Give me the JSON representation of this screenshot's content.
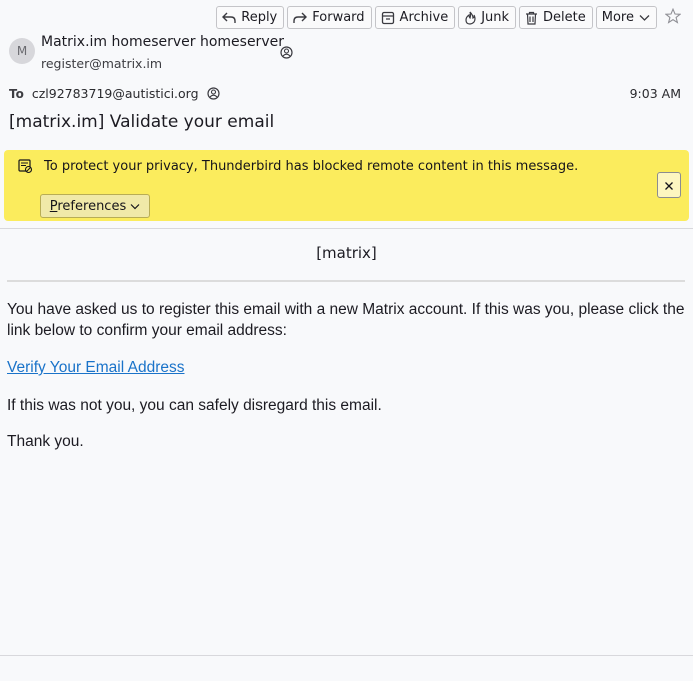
{
  "toolbar": {
    "reply_label": "Reply",
    "forward_label": "Forward",
    "archive_label": "Archive",
    "junk_label": "Junk",
    "delete_label": "Delete",
    "more_label": "More"
  },
  "sender": {
    "avatar_initial": "M",
    "name": "Matrix.im homeserver homeserver",
    "address": "register@matrix.im"
  },
  "recipient": {
    "label": "To",
    "address": "czl92783719@autistici.org"
  },
  "message": {
    "time": "9:03 AM",
    "subject": "[matrix.im] Validate your email"
  },
  "notification": {
    "text": "To protect your privacy, Thunderbird has blocked remote content in this message.",
    "preferences_first": "P",
    "preferences_rest": "references",
    "background_color": "#fbec5d"
  },
  "body": {
    "brand": "[matrix]",
    "paragraph1": "You have asked us to register this email with a new Matrix account. If this was you, please click the link below to confirm your email address:",
    "link_text": "Verify Your Email Address",
    "paragraph2": "If this was not you, you can safely disregard this email.",
    "paragraph3": "Thank you.",
    "link_color": "#1a73c9"
  }
}
